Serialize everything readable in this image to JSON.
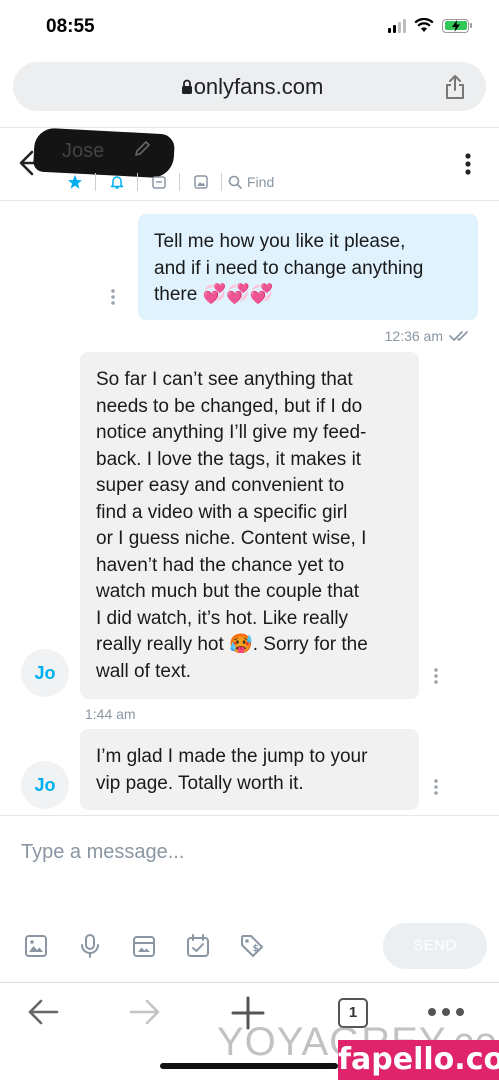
{
  "status_bar": {
    "time": "08:55"
  },
  "browser": {
    "url": "onlyfans.com",
    "tab_count": "1"
  },
  "chat": {
    "contact_name": "Jose",
    "find_label": "Find"
  },
  "messages": [
    {
      "direction": "outgoing",
      "lines": [
        "Tell me how you like it please,",
        "and if i need to change anything",
        "there 💞💞💞"
      ],
      "time": "12:36 am",
      "read": true
    },
    {
      "direction": "incoming",
      "avatar_initials": "Jo",
      "lines": [
        "So far I can’t see anything that",
        "needs to be changed, but if I do",
        "notice anything I’ll give my feed-",
        "back. I love the tags, it makes it",
        "super easy and convenient to",
        "find a video with a specific girl",
        "or I guess niche. Content wise, I",
        "haven’t had the chance yet to",
        "watch much but the couple that",
        "I did watch, it’s hot. Like really",
        "really really hot 🥵. Sorry for the",
        "wall of text."
      ],
      "time": "1:44 am"
    },
    {
      "direction": "incoming",
      "avatar_initials": "Jo",
      "lines": [
        "I’m glad I made the jump to your",
        "vip page. Totally worth it."
      ]
    }
  ],
  "compose": {
    "placeholder": "Type a message...",
    "send_label": "SEND"
  },
  "watermarks": {
    "left": "YOYAGREY.com",
    "right": "fapello.com"
  },
  "colors": {
    "accent": "#00aff0",
    "outgoing_bubble": "#dff2fd",
    "incoming_bubble": "#f1f1f1",
    "muted": "#8a96a3",
    "watermark_bg": "#e0246c"
  }
}
